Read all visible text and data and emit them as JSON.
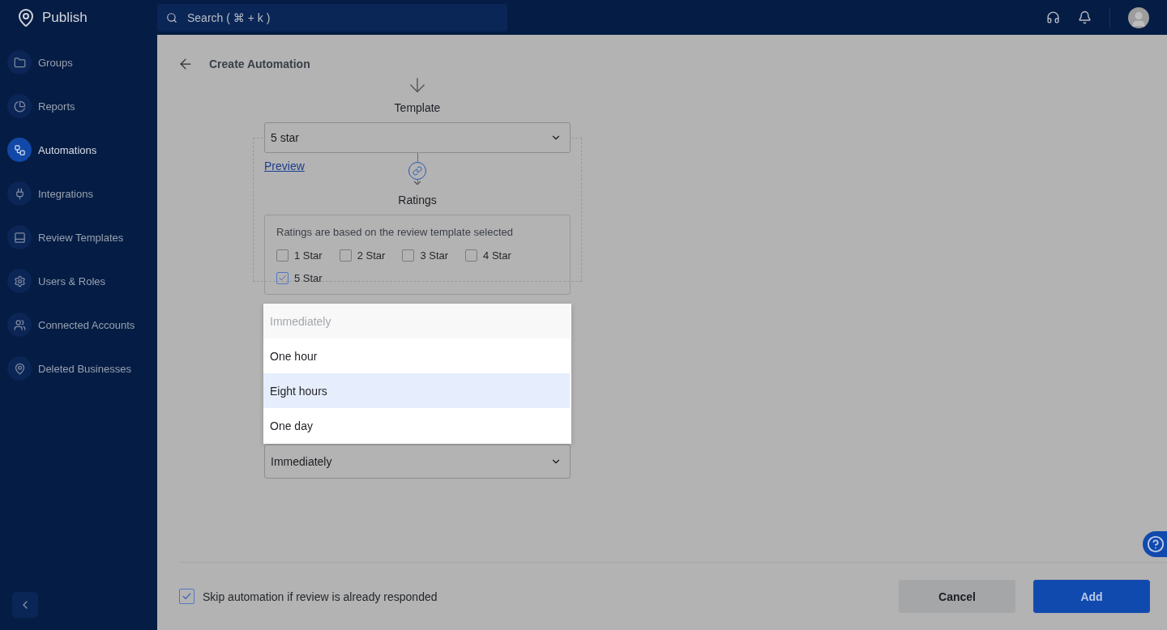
{
  "app": {
    "name": "Publish"
  },
  "search": {
    "placeholder": "Search ( ⌘ + k )"
  },
  "sidebar": {
    "items": [
      {
        "label": "Groups",
        "selected": false
      },
      {
        "label": "Reports",
        "selected": false
      },
      {
        "label": "Automations",
        "selected": true
      },
      {
        "label": "Integrations",
        "selected": false
      },
      {
        "label": "Review Templates",
        "selected": false
      },
      {
        "label": "Users & Roles",
        "selected": false
      },
      {
        "label": "Connected Accounts",
        "selected": false
      },
      {
        "label": "Deleted Businesses",
        "selected": false
      }
    ]
  },
  "page": {
    "title": "Create Automation"
  },
  "template": {
    "label": "Template",
    "value": "5 star",
    "link": "Preview"
  },
  "ratings": {
    "label": "Ratings",
    "hint": "Ratings are based on the review template selected",
    "options": [
      {
        "label": "1 Star",
        "checked": false
      },
      {
        "label": "2 Star",
        "checked": false
      },
      {
        "label": "3 Star",
        "checked": false
      },
      {
        "label": "4 Star",
        "checked": false
      },
      {
        "label": "5 Star",
        "checked": true
      }
    ]
  },
  "timing": {
    "value": "Immediately",
    "menu": [
      {
        "label": "Immediately",
        "selected": true,
        "highlighted": false
      },
      {
        "label": "One hour",
        "selected": false,
        "highlighted": false
      },
      {
        "label": "Eight hours",
        "selected": false,
        "highlighted": true
      },
      {
        "label": "One day",
        "selected": false,
        "highlighted": false
      }
    ]
  },
  "footer": {
    "skip": {
      "label": "Skip automation if review is already responded",
      "checked": true
    },
    "buttons": [
      "Cancel",
      "Add"
    ]
  }
}
